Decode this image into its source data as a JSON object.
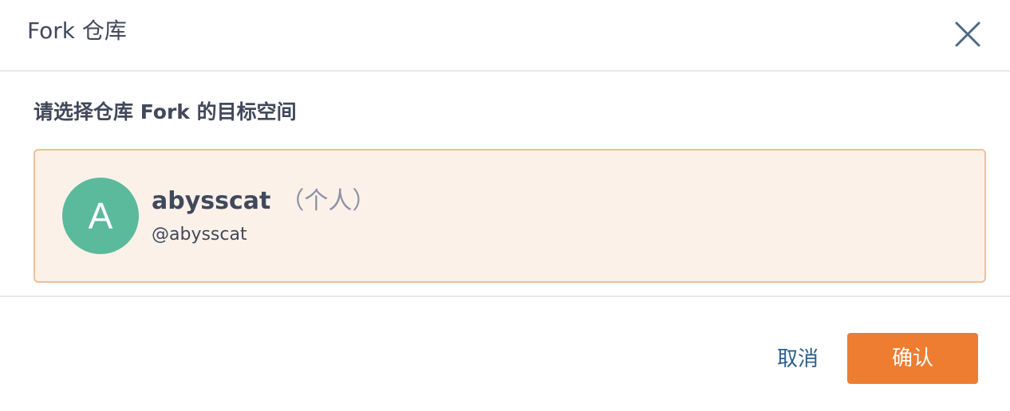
{
  "dialog": {
    "title": "Fork 仓库",
    "close_icon": "close-icon",
    "prompt": "请选择仓库 Fork 的目标空间"
  },
  "namespaces": [
    {
      "avatar_letter": "A",
      "avatar_color": "#5bba9c",
      "name": "abysscat",
      "type_label": "（个人）",
      "handle": "@abysscat",
      "selected": true
    }
  ],
  "footer": {
    "cancel_label": "取消",
    "confirm_label": "确认"
  },
  "colors": {
    "accent": "#ee7d31",
    "selected_bg": "#fcf1e9",
    "selected_border": "#f4bd92",
    "link": "#2b5e8c",
    "text": "#40485b",
    "muted": "#8c92a4"
  }
}
